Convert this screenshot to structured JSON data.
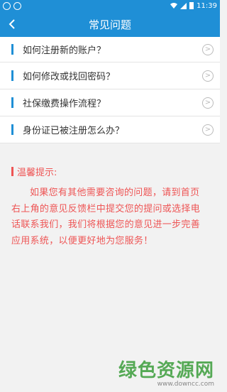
{
  "status_bar": {
    "time": "11:39"
  },
  "header": {
    "title": "常见问题",
    "back_icon": "back-arrow-icon"
  },
  "faq": [
    {
      "label": "如何注册新的账户？"
    },
    {
      "label": "如何修改或找回密码？"
    },
    {
      "label": "社保缴费操作流程？"
    },
    {
      "label": "身份证已被注册怎么办？"
    }
  ],
  "tips": {
    "title": "温馨提示:",
    "body": "如果您有其他需要咨询的问题，请到首页右上角的意见反馈栏中提交您的提问或选择电话联系我们，我们将根据您的意见进一步完善应用系统，以便更好地为您服务！"
  },
  "watermark": {
    "name": "绿色资源网",
    "url": "www.downcc.com"
  },
  "colors": {
    "primary": "#1f8fd6",
    "tips": "#ee5555",
    "watermark": "#3a9d3a"
  }
}
